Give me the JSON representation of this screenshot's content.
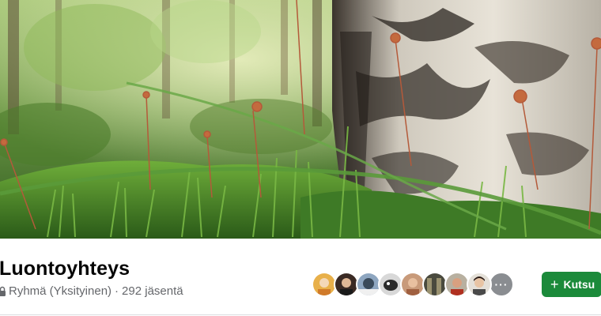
{
  "cover": {
    "description_icon": "cover-photo"
  },
  "group": {
    "name": "Luontoyhteys",
    "privacy": "Ryhmä (Yksityinen)",
    "separator": "·",
    "member_count": "292 jäsentä"
  },
  "members": {
    "more_label": "···"
  },
  "actions": {
    "invite_label": "Kutsu",
    "invite_icon": "plus-icon",
    "accent": "#1b8a3a"
  }
}
